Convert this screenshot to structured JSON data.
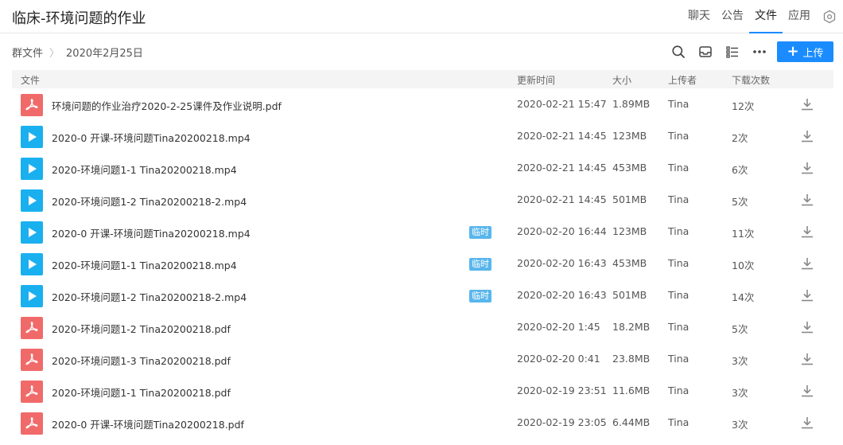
{
  "header": {
    "title": "临床-环境问题的作业",
    "tabs": [
      {
        "label": "聊天",
        "active": false
      },
      {
        "label": "公告",
        "active": false
      },
      {
        "label": "文件",
        "active": true
      },
      {
        "label": "应用",
        "active": false
      }
    ]
  },
  "toolbar": {
    "breadcrumb_root": "群文件",
    "breadcrumb_current": "2020年2月25日",
    "upload_label": "上传"
  },
  "table": {
    "headers": {
      "file": "文件",
      "updated": "更新时间",
      "size": "大小",
      "uploader": "上传者",
      "downloads": "下载次数"
    },
    "rows": [
      {
        "type": "pdf",
        "name": "环境问题的作业治疗2020-2-25课件及作业说明.pdf",
        "tag": "",
        "time": "2020-02-21 15:47",
        "size": "1.89MB",
        "uploader": "Tina",
        "downloads": "12次"
      },
      {
        "type": "mp4",
        "name": "2020-0 开课-环境问题Tina20200218.mp4",
        "tag": "",
        "time": "2020-02-21 14:45",
        "size": "123MB",
        "uploader": "Tina",
        "downloads": "2次"
      },
      {
        "type": "mp4",
        "name": "2020-环境问题1-1 Tina20200218.mp4",
        "tag": "",
        "time": "2020-02-21 14:45",
        "size": "453MB",
        "uploader": "Tina",
        "downloads": "6次"
      },
      {
        "type": "mp4",
        "name": "2020-环境问题1-2 Tina20200218-2.mp4",
        "tag": "",
        "time": "2020-02-21 14:45",
        "size": "501MB",
        "uploader": "Tina",
        "downloads": "5次"
      },
      {
        "type": "mp4",
        "name": "2020-0 开课-环境问题Tina20200218.mp4",
        "tag": "临时",
        "time": "2020-02-20 16:44",
        "size": "123MB",
        "uploader": "Tina",
        "downloads": "11次"
      },
      {
        "type": "mp4",
        "name": "2020-环境问题1-1 Tina20200218.mp4",
        "tag": "临时",
        "time": "2020-02-20 16:43",
        "size": "453MB",
        "uploader": "Tina",
        "downloads": "10次"
      },
      {
        "type": "mp4",
        "name": "2020-环境问题1-2 Tina20200218-2.mp4",
        "tag": "临时",
        "time": "2020-02-20 16:43",
        "size": "501MB",
        "uploader": "Tina",
        "downloads": "14次"
      },
      {
        "type": "pdf",
        "name": "2020-环境问题1-2 Tina20200218.pdf",
        "tag": "",
        "time": "2020-02-20 1:45",
        "size": "18.2MB",
        "uploader": "Tina",
        "downloads": "5次"
      },
      {
        "type": "pdf",
        "name": "2020-环境问题1-3 Tina20200218.pdf",
        "tag": "",
        "time": "2020-02-20 0:41",
        "size": "23.8MB",
        "uploader": "Tina",
        "downloads": "3次"
      },
      {
        "type": "pdf",
        "name": "2020-环境问题1-1 Tina20200218.pdf",
        "tag": "",
        "time": "2020-02-19 23:51",
        "size": "11.6MB",
        "uploader": "Tina",
        "downloads": "3次"
      },
      {
        "type": "pdf",
        "name": "2020-0 开课-环境问题Tina20200218.pdf",
        "tag": "",
        "time": "2020-02-19 23:05",
        "size": "6.44MB",
        "uploader": "Tina",
        "downloads": "3次"
      }
    ]
  },
  "icons": {
    "pdf": "pdf-file-icon",
    "mp4": "video-file-icon",
    "download": "download-icon",
    "search": "search-icon",
    "inbox": "inbox-icon",
    "list": "list-view-icon",
    "more": "more-icon",
    "settings": "settings-hexagon-icon"
  },
  "colors": {
    "accent": "#1a8cff",
    "pdf": "#f16a6a",
    "video": "#1ab0f0",
    "tag": "#59b6ec"
  }
}
